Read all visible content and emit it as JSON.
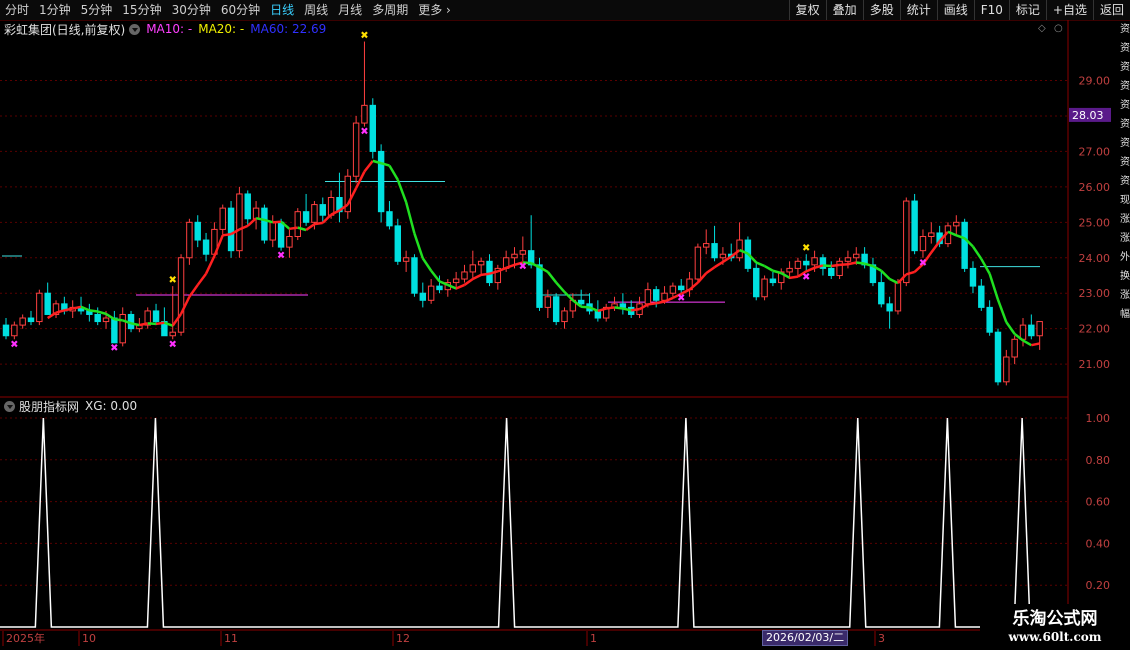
{
  "toolbar": {
    "periods": [
      "分时",
      "1分钟",
      "5分钟",
      "15分钟",
      "30分钟",
      "60分钟",
      "日线",
      "周线",
      "月线",
      "多周期",
      "更多"
    ],
    "active_period": "日线",
    "right_buttons": [
      "复权",
      "叠加",
      "多股",
      "统计",
      "画线",
      "F10",
      "标记",
      "+自选",
      "返回"
    ]
  },
  "info": {
    "stock_name": "彩虹集团(日线,前复权)",
    "ma10_label": "MA10: -",
    "ma20_label": "MA20: -",
    "ma60_label": "MA60: 22.69"
  },
  "sub_indicator": {
    "name": "股朋指标网",
    "value_label": "XG: 0.00"
  },
  "price_axis": {
    "ticks": [
      "29.00",
      "28.00",
      "27.00",
      "26.00",
      "25.00",
      "24.00",
      "23.00",
      "22.00",
      "21.00"
    ],
    "current_price": "28.03"
  },
  "sub_axis": {
    "ticks": [
      "1.00",
      "0.80",
      "0.60",
      "0.40",
      "0.20"
    ]
  },
  "time_axis": {
    "labels": [
      "2025年",
      "10",
      "11",
      "12",
      "1",
      "3"
    ],
    "cursor_date": "2026/02/03/二"
  },
  "watermark": {
    "line1": "乐淘公式网",
    "line2": "www.60lt.com"
  },
  "side_text": "资 资 资 资 资 资 资 资 资 现 涨 涨 外 换 涨 幅",
  "colors": {
    "up": "#ff4040",
    "down": "#00e0e0",
    "ma_up": "#ff2020",
    "ma_down": "#20e020",
    "grid": "#5a0000",
    "signal": "#ff30ff",
    "star": "#ffe000",
    "axis_text": "#c04040",
    "price_tag_bg": "#5a1a8a"
  },
  "chart_data": {
    "type": "candlestick",
    "price_range": [
      20.1,
      30.2
    ],
    "candles": [
      [
        22.1,
        22.3,
        21.7,
        21.8
      ],
      [
        21.8,
        22.2,
        21.7,
        22.1
      ],
      [
        22.1,
        22.4,
        22.0,
        22.3
      ],
      [
        22.3,
        22.5,
        22.1,
        22.2
      ],
      [
        22.2,
        23.1,
        22.1,
        23.0
      ],
      [
        23.0,
        23.3,
        22.5,
        22.4
      ],
      [
        22.4,
        22.8,
        22.3,
        22.7
      ],
      [
        22.7,
        22.9,
        22.4,
        22.5
      ],
      [
        22.5,
        22.8,
        22.3,
        22.6
      ],
      [
        22.6,
        22.9,
        22.4,
        22.5
      ],
      [
        22.5,
        22.7,
        22.2,
        22.4
      ],
      [
        22.4,
        22.6,
        22.1,
        22.2
      ],
      [
        22.2,
        22.5,
        22.0,
        22.3
      ],
      [
        22.3,
        22.5,
        21.6,
        21.6
      ],
      [
        21.6,
        22.6,
        21.5,
        22.4
      ],
      [
        22.4,
        22.5,
        21.9,
        22.0
      ],
      [
        22.0,
        22.3,
        21.9,
        22.1
      ],
      [
        22.1,
        22.6,
        22.0,
        22.5
      ],
      [
        22.5,
        22.7,
        22.1,
        22.2
      ],
      [
        22.2,
        22.6,
        22.0,
        21.8
      ],
      [
        21.8,
        23.2,
        21.7,
        21.9
      ],
      [
        21.9,
        24.1,
        21.8,
        24.0
      ],
      [
        24.0,
        25.1,
        23.8,
        25.0
      ],
      [
        25.0,
        25.2,
        24.3,
        24.5
      ],
      [
        24.5,
        24.7,
        23.9,
        24.1
      ],
      [
        24.1,
        25.0,
        24.0,
        24.8
      ],
      [
        24.8,
        25.5,
        24.6,
        25.4
      ],
      [
        25.4,
        25.6,
        24.0,
        24.2
      ],
      [
        24.2,
        26.0,
        24.0,
        25.8
      ],
      [
        25.8,
        25.9,
        24.9,
        25.1
      ],
      [
        25.1,
        25.6,
        24.8,
        25.4
      ],
      [
        25.4,
        25.5,
        24.4,
        24.5
      ],
      [
        24.5,
        25.2,
        24.3,
        25.0
      ],
      [
        25.0,
        25.1,
        24.2,
        24.3
      ],
      [
        24.3,
        24.8,
        24.0,
        24.6
      ],
      [
        24.6,
        25.4,
        24.5,
        25.3
      ],
      [
        25.3,
        25.8,
        24.9,
        25.0
      ],
      [
        25.0,
        25.6,
        24.8,
        25.5
      ],
      [
        25.5,
        25.7,
        25.0,
        25.2
      ],
      [
        25.2,
        25.9,
        25.1,
        25.7
      ],
      [
        25.7,
        26.4,
        25.0,
        25.3
      ],
      [
        25.3,
        26.5,
        25.1,
        26.3
      ],
      [
        26.3,
        28.0,
        26.1,
        27.8
      ],
      [
        27.8,
        30.1,
        27.7,
        28.3
      ],
      [
        28.3,
        28.5,
        26.8,
        27.0
      ],
      [
        27.0,
        27.2,
        25.0,
        25.3
      ],
      [
        25.3,
        25.6,
        24.8,
        24.9
      ],
      [
        24.9,
        25.1,
        23.8,
        23.9
      ],
      [
        23.9,
        24.2,
        23.6,
        24.0
      ],
      [
        24.0,
        24.1,
        22.9,
        23.0
      ],
      [
        23.0,
        23.3,
        22.6,
        22.8
      ],
      [
        22.8,
        23.4,
        22.7,
        23.2
      ],
      [
        23.2,
        23.5,
        23.0,
        23.1
      ],
      [
        23.1,
        23.4,
        22.9,
        23.3
      ],
      [
        23.3,
        23.6,
        23.1,
        23.4
      ],
      [
        23.4,
        23.8,
        23.3,
        23.6
      ],
      [
        23.6,
        24.2,
        23.4,
        23.8
      ],
      [
        23.8,
        24.0,
        23.5,
        23.9
      ],
      [
        23.9,
        24.1,
        23.2,
        23.3
      ],
      [
        23.3,
        23.8,
        23.1,
        23.7
      ],
      [
        23.7,
        24.2,
        23.6,
        24.0
      ],
      [
        24.0,
        24.3,
        23.7,
        24.1
      ],
      [
        24.1,
        24.6,
        23.9,
        24.2
      ],
      [
        24.2,
        25.2,
        23.7,
        23.8
      ],
      [
        23.8,
        24.0,
        22.5,
        22.6
      ],
      [
        22.6,
        23.1,
        22.3,
        22.9
      ],
      [
        22.9,
        23.0,
        22.1,
        22.2
      ],
      [
        22.2,
        22.6,
        22.0,
        22.5
      ],
      [
        22.5,
        23.0,
        22.3,
        22.8
      ],
      [
        22.8,
        23.1,
        22.6,
        22.7
      ],
      [
        22.7,
        23.0,
        22.4,
        22.5
      ],
      [
        22.5,
        22.8,
        22.2,
        22.3
      ],
      [
        22.3,
        22.7,
        22.2,
        22.6
      ],
      [
        22.6,
        22.9,
        22.5,
        22.7
      ],
      [
        22.7,
        23.0,
        22.4,
        22.6
      ],
      [
        22.6,
        22.8,
        22.3,
        22.4
      ],
      [
        22.4,
        22.9,
        22.3,
        22.7
      ],
      [
        22.7,
        23.3,
        22.6,
        23.1
      ],
      [
        23.1,
        23.2,
        22.6,
        22.8
      ],
      [
        22.8,
        23.2,
        22.7,
        23.0
      ],
      [
        23.0,
        23.3,
        22.9,
        23.2
      ],
      [
        23.2,
        23.4,
        23.0,
        23.1
      ],
      [
        23.1,
        23.6,
        22.9,
        23.4
      ],
      [
        23.4,
        24.4,
        23.3,
        24.3
      ],
      [
        24.3,
        24.8,
        24.1,
        24.4
      ],
      [
        24.4,
        24.9,
        23.9,
        24.0
      ],
      [
        24.0,
        24.3,
        23.8,
        24.1
      ],
      [
        24.1,
        24.4,
        23.9,
        24.0
      ],
      [
        24.0,
        25.0,
        23.9,
        24.5
      ],
      [
        24.5,
        24.6,
        23.6,
        23.7
      ],
      [
        23.7,
        23.9,
        22.8,
        22.9
      ],
      [
        22.9,
        23.5,
        22.8,
        23.4
      ],
      [
        23.4,
        23.6,
        23.2,
        23.3
      ],
      [
        23.3,
        23.7,
        23.1,
        23.6
      ],
      [
        23.6,
        23.9,
        23.4,
        23.7
      ],
      [
        23.7,
        24.0,
        23.5,
        23.9
      ],
      [
        23.9,
        24.1,
        23.6,
        23.8
      ],
      [
        23.8,
        24.2,
        23.6,
        24.0
      ],
      [
        24.0,
        24.1,
        23.5,
        23.7
      ],
      [
        23.7,
        23.9,
        23.4,
        23.5
      ],
      [
        23.5,
        24.0,
        23.4,
        23.9
      ],
      [
        23.9,
        24.2,
        23.7,
        24.0
      ],
      [
        24.0,
        24.3,
        23.8,
        24.1
      ],
      [
        24.1,
        24.3,
        23.7,
        23.8
      ],
      [
        23.8,
        24.0,
        23.2,
        23.3
      ],
      [
        23.3,
        23.6,
        22.6,
        22.7
      ],
      [
        22.7,
        22.9,
        22.0,
        22.5
      ],
      [
        22.5,
        23.4,
        22.4,
        23.3
      ],
      [
        23.3,
        25.7,
        23.2,
        25.6
      ],
      [
        25.6,
        25.8,
        24.1,
        24.2
      ],
      [
        24.2,
        24.8,
        24.0,
        24.6
      ],
      [
        24.6,
        25.0,
        24.4,
        24.7
      ],
      [
        24.7,
        24.9,
        24.3,
        24.4
      ],
      [
        24.4,
        25.0,
        24.3,
        24.9
      ],
      [
        24.9,
        25.2,
        24.6,
        25.0
      ],
      [
        25.0,
        25.1,
        23.6,
        23.7
      ],
      [
        23.7,
        23.9,
        23.0,
        23.2
      ],
      [
        23.2,
        23.4,
        22.5,
        22.6
      ],
      [
        22.6,
        22.8,
        21.8,
        21.9
      ],
      [
        21.9,
        22.0,
        20.4,
        20.5
      ],
      [
        20.5,
        21.4,
        20.4,
        21.2
      ],
      [
        21.2,
        21.8,
        21.0,
        21.7
      ],
      [
        21.7,
        22.3,
        21.5,
        22.1
      ],
      [
        22.1,
        22.4,
        21.7,
        21.8
      ],
      [
        21.8,
        22.2,
        21.4,
        22.2
      ]
    ],
    "ma60_break_index": 44,
    "signal_indices": [
      1,
      13,
      20,
      33,
      43,
      62,
      81,
      96,
      110
    ],
    "star_indices": [
      20,
      43,
      96
    ],
    "xg_pulse_indices": [
      5,
      20,
      67,
      91,
      114,
      126,
      136
    ]
  }
}
